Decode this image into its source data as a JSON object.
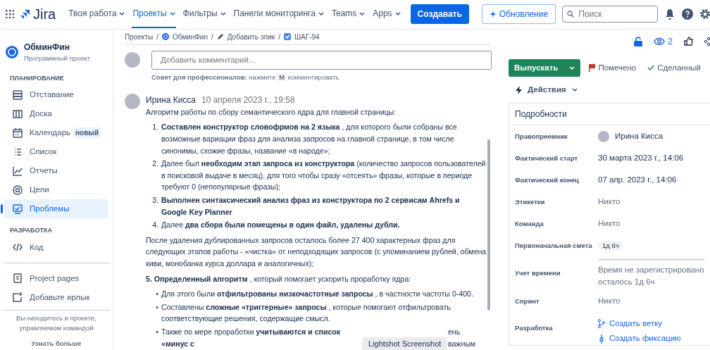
{
  "topnav": {
    "logo": "Jira",
    "menus": [
      {
        "label": "Твоя работа",
        "selected": false
      },
      {
        "label": "Проекты",
        "selected": true
      },
      {
        "label": "Фильтры",
        "selected": false
      },
      {
        "label": "Панели мониторинга",
        "selected": false
      },
      {
        "label": "Teams",
        "selected": false
      },
      {
        "label": "Apps",
        "selected": false
      }
    ],
    "create": "Создавать",
    "update": "Обновление",
    "search": {
      "placeholder": "Поиск"
    }
  },
  "sidebar": {
    "project": {
      "name": "ОбминФин",
      "type": "Программный проект"
    },
    "sections": [
      {
        "title": "ПЛАНИРОВАНИЕ",
        "items": [
          {
            "label": "Отставание",
            "selected": false
          },
          {
            "label": "Доска",
            "selected": false
          },
          {
            "label": "Календарь",
            "badge": "новый",
            "selected": false
          },
          {
            "label": "Список",
            "selected": false
          },
          {
            "label": "Отчеты",
            "selected": false
          },
          {
            "label": "Цели",
            "selected": false
          },
          {
            "label": "Проблемы",
            "selected": true
          }
        ]
      },
      {
        "title": "РАЗРАБОТКА",
        "items": [
          {
            "label": "Код",
            "selected": false
          }
        ]
      }
    ],
    "links": [
      {
        "label": "Project pages"
      },
      {
        "label": "Добавьте ярлык"
      }
    ],
    "footer": {
      "text": "Вы находитесь в проекте, управляемом командой",
      "link": "Узнать больше"
    }
  },
  "breadcrumbs": [
    {
      "label": "Проекты"
    },
    {
      "separator": "/",
      "label": "ОбминФин"
    },
    {
      "separator": "/",
      "label": "Добавить эпик"
    },
    {
      "separator": "/",
      "label": "ШАГ-94"
    }
  ],
  "comment_box": {
    "placeholder": "Добавить комментарий...",
    "tip_label": "Совет для профессионалов:",
    "tip_pre": "нажмите",
    "tip_key": "M",
    "tip_post": "комментировать"
  },
  "comment": {
    "author": "Ирина Кисса",
    "date": "10 апреля 2023 г., 19:58",
    "blocks": [
      {
        "kind": "p",
        "text": "Алгоритм работы по сбору семантического ядра для главной страницы:"
      },
      {
        "kind": "list",
        "items": [
          {
            "marker": "1.",
            "text": "**Составлен конструктор словофрмов на 2 языка** , для которого были собраны все возможные вариации фраз для анализа запросов на главной странице, в том числе синонимы, схожие фразы, название «в народе»;"
          },
          {
            "marker": "2.",
            "text": "Далее был **необходим этап запроса из конструктора** (количество запросов пользователей в поисковой выдаче в месяц), для того чтобы сразу «отсеять» фразы, которые в периоде требуют 0 (непопулярные фразы);"
          },
          {
            "marker": "3.",
            "text": "**Выполнен синтаксический анализ фраз из конструктора по 2 сервисам Ahrefs и Google Key Planner**"
          },
          {
            "marker": "4.",
            "text": "Далее **два сбора были помещены в один файл, удалены дубли.**"
          }
        ]
      },
      {
        "kind": "p",
        "text": "После удаления дублированных запросов осталось более 27 400 характерных фраз для следующих этапов работы - «чистка» от неподходящих запросов (с упоминанием рублей, обмена киви, монобанка курса доллара и аналогичных);"
      },
      {
        "kind": "p",
        "text": "**5. Определенный алгоритм** , который помогает ускорить проработку ядра:"
      },
      {
        "kind": "list",
        "items": [
          {
            "marker": "•",
            "text": "Для этого были **отфильтрованы низкочастотные запросы** , в частности частоты 0-400."
          },
          {
            "marker": "•",
            "text": "Составлены **сложные «триггерные» запросы** , которые помогают отфильтровать соответствующие решения, содержащие смысл."
          },
          {
            "marker": "•",
            "text": "Также по мере проработки **учитываются и список «минус с**",
            "tail": "ень важным"
          }
        ]
      }
    ]
  },
  "tooltip": "Lightshot Screenshot",
  "issue_actions": {
    "watchers": "2",
    "status": "Выпускать",
    "flag": "Помечено",
    "resolution": "Сделанный",
    "actions": "Действия"
  },
  "details": {
    "title": "Подробности",
    "fields": [
      {
        "label": "Правопреемник",
        "kind": "person",
        "value": "Ирина Кисса"
      },
      {
        "label": "Фактический старт",
        "kind": "text",
        "value": "30 марта 2023 г., 14:06"
      },
      {
        "label": "Фактический конец",
        "kind": "text",
        "value": "07 апр. 2023 г., 14:06"
      },
      {
        "label": "Этикетки",
        "kind": "muted",
        "value": "Никто"
      },
      {
        "label": "Команда",
        "kind": "muted",
        "value": "Никто"
      },
      {
        "label": "Первоначальная смета",
        "kind": "badge",
        "value": "1д 6ч"
      },
      {
        "label": "Учет времени",
        "kind": "tracking",
        "level": 0,
        "value": "Время не зарегистрировано",
        "note": "осталось 1д 6ч"
      },
      {
        "label": "Спринт",
        "kind": "muted",
        "value": "Никто"
      },
      {
        "label": "Разработка",
        "kind": "links",
        "links": [
          {
            "label": "Создать ветку"
          },
          {
            "label": "Создать фиксацию"
          }
        ]
      }
    ]
  }
}
